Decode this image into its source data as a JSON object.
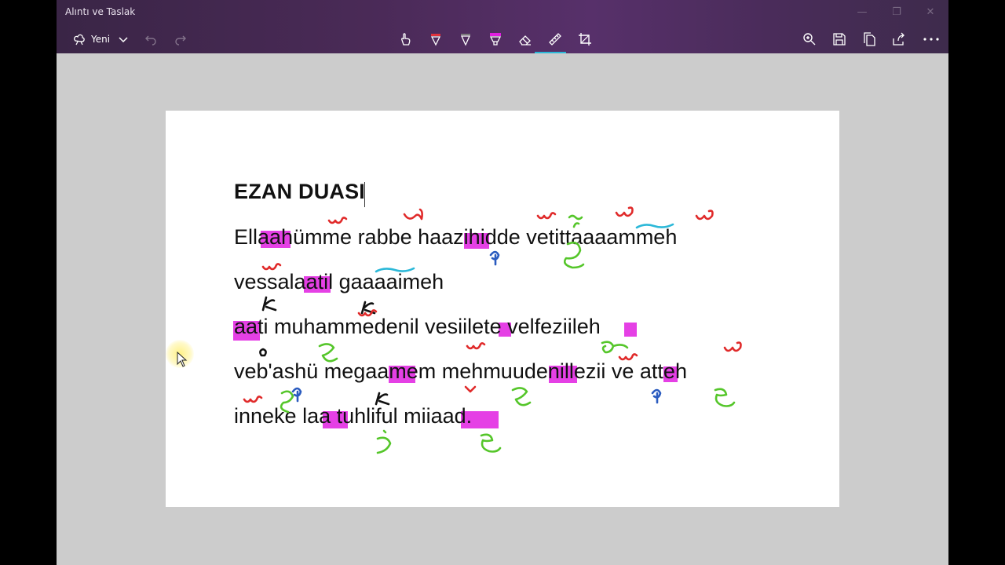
{
  "window": {
    "title": "Alıntı ve Taslak"
  },
  "toolbar": {
    "new_label": "Yeni",
    "icons": [
      "new-snip-icon",
      "chevron-down-icon",
      "undo-icon",
      "redo-icon",
      "touch-writing-icon",
      "ballpoint-pen-icon",
      "pencil-icon",
      "highlighter-icon",
      "eraser-icon",
      "ruler-icon",
      "crop-icon",
      "zoom-icon",
      "save-icon",
      "copy-icon",
      "share-icon",
      "more-icon"
    ],
    "accent_color": "#2bb8d8"
  },
  "document": {
    "heading": "EZAN DUASI",
    "lines": [
      "Ellaahümme rabbe haazihidde vetittaaaammeh",
      "vessalaatil gaaaaimeh",
      "aati muhammedenil vesiilete velfeziileh",
      "veb'ashü megaamem mehmuudenillezii ve atteh",
      "inneke laa tuhliful miiaad."
    ],
    "highlight_color": "#e01ee0"
  }
}
